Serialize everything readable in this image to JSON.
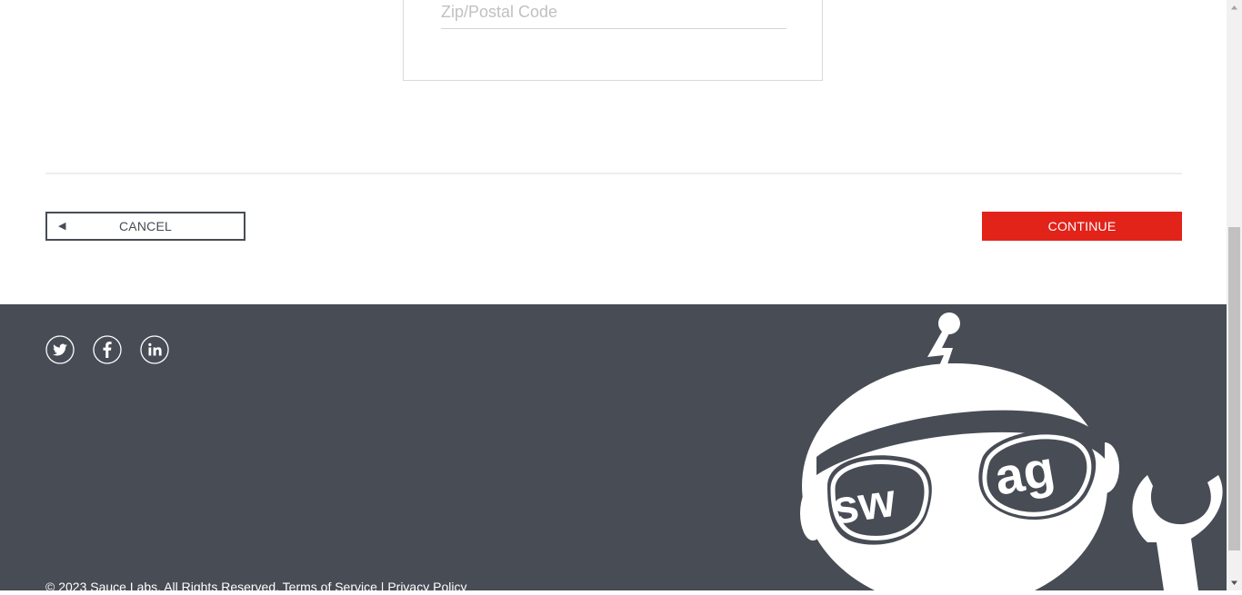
{
  "checkout_form": {
    "zip_placeholder": "Zip/Postal Code",
    "zip_value": ""
  },
  "actions": {
    "cancel_label": "CANCEL",
    "continue_label": "CONTINUE"
  },
  "footer": {
    "social_icons": [
      "twitter-icon",
      "facebook-icon",
      "linkedin-icon"
    ],
    "copyright": "© 2023 Sauce Labs. All Rights Reserved. Terms of Service | Privacy Policy",
    "mascot_text": "swag"
  },
  "colors": {
    "accent": "#e2231a",
    "footer_bg": "#474c55",
    "button_border": "#474c55"
  }
}
